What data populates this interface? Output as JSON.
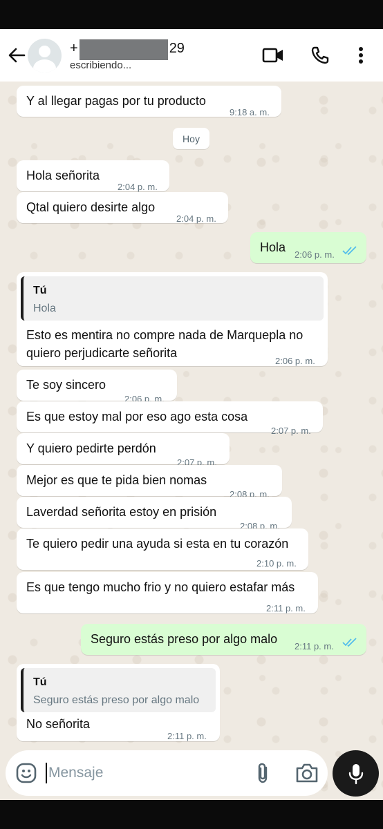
{
  "header": {
    "contact_prefix": "+",
    "contact_suffix": "29",
    "status": "escribiendo..."
  },
  "date_chip": "Hoy",
  "messages": [
    {
      "dir": "in",
      "text": "Y al llegar pagas por tu producto",
      "time": "9:18 a. m."
    },
    {
      "dir": "in",
      "text": "Hola señorita",
      "time": "2:04 p. m."
    },
    {
      "dir": "in",
      "text": "Qtal quiero desirte algo",
      "time": "2:04 p. m."
    },
    {
      "dir": "out",
      "text": "Hola",
      "time": "2:06 p. m.",
      "read": true
    },
    {
      "dir": "in",
      "quote_author": "Tú",
      "quote_text": "Hola",
      "text": "Esto es mentira no compre nada de Marquepla no quiero perjudicarte señorita",
      "time": "2:06 p. m."
    },
    {
      "dir": "in",
      "text": "Te soy sincero",
      "time": "2:06 p. m."
    },
    {
      "dir": "in",
      "text": "Es que estoy mal por eso ago esta cosa",
      "time": "2:07 p. m."
    },
    {
      "dir": "in",
      "text": "Y quiero pedirte perdón",
      "time": "2:07 p. m."
    },
    {
      "dir": "in",
      "text": "Mejor es que te pida bien nomas",
      "time": "2:08 p. m."
    },
    {
      "dir": "in",
      "text": "Laverdad señorita estoy en prisión",
      "time": "2:08 p. m."
    },
    {
      "dir": "in",
      "text": "Te quiero pedir una ayuda si esta en tu corazón",
      "time": "2:10 p. m."
    },
    {
      "dir": "in",
      "text": "Es que tengo mucho frio y no quiero estafar más",
      "time": "2:11 p. m."
    },
    {
      "dir": "out",
      "text": "Seguro estás preso por algo malo",
      "time": "2:11 p. m.",
      "read": true
    },
    {
      "dir": "in",
      "quote_author": "Tú",
      "quote_text": "Seguro estás preso por algo malo",
      "text": "No señorita",
      "time": "2:11 p. m."
    }
  ],
  "composer": {
    "placeholder": "Mensaje"
  },
  "colors": {
    "incoming_bubble": "#ffffff",
    "outgoing_bubble": "#d9fdd3",
    "chat_background": "#efeae2",
    "read_ticks": "#53bdeb"
  }
}
